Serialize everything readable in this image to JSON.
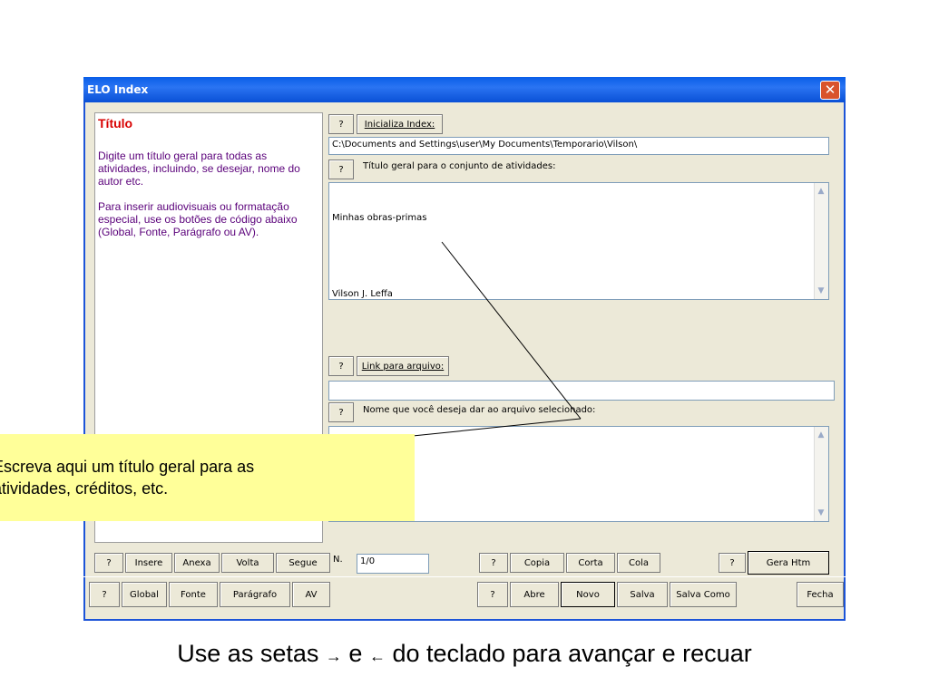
{
  "window": {
    "title": "ELO Index",
    "close_glyph": "✕"
  },
  "help": {
    "title": "Título",
    "body": "Digite um título geral para todas as atividades, incluindo, se desejar, nome do autor etc.\n\nPara inserir audiovisuais ou formatação especial, use os botões de código abaixo  (Global, Fonte, Parágrafo ou AV)."
  },
  "form": {
    "help_btn": "?",
    "init_index_btn": "Inicializa Index:",
    "path_value": "C:\\Documents and Settings\\user\\My Documents\\Temporario\\Vilson\\",
    "title_label": "Título geral para o conjunto de atividades:",
    "title_line1": "Minhas obras-primas",
    "title_line2": "Vilson J. Leffa",
    "link_btn": "Link para arquivo:",
    "link_value": "",
    "filename_label": "Nome que você deseja dar ao arquivo selecionado:",
    "filename_value": ""
  },
  "toolbar1": {
    "help": "?",
    "insere": "Insere",
    "anexa": "Anexa",
    "volta": "Volta",
    "segue": "Segue",
    "n_label": "N.",
    "n_value": "1/0",
    "help2": "?",
    "copia": "Copia",
    "corta": "Corta",
    "cola": "Cola",
    "help3": "?",
    "gera_htm": "Gera Htm"
  },
  "toolbar2": {
    "help": "?",
    "global": "Global",
    "fonte": "Fonte",
    "paragrafo": "Parágrafo",
    "av": "AV",
    "help2": "?",
    "abre": "Abre",
    "novo": "Novo",
    "salva": "Salva",
    "salva_como": "Salva Como",
    "fecha": "Fecha"
  },
  "tooltip": {
    "line1": "Escreva aqui um título geral para as",
    "line2": "atividades, créditos, etc."
  },
  "caption": {
    "text1": "Use as setas",
    "arrow_right": "→",
    "text2": "e",
    "arrow_left": "←",
    "text3": "do teclado para avançar e recuar"
  },
  "scroll": {
    "up": "▲",
    "down": "▼"
  }
}
